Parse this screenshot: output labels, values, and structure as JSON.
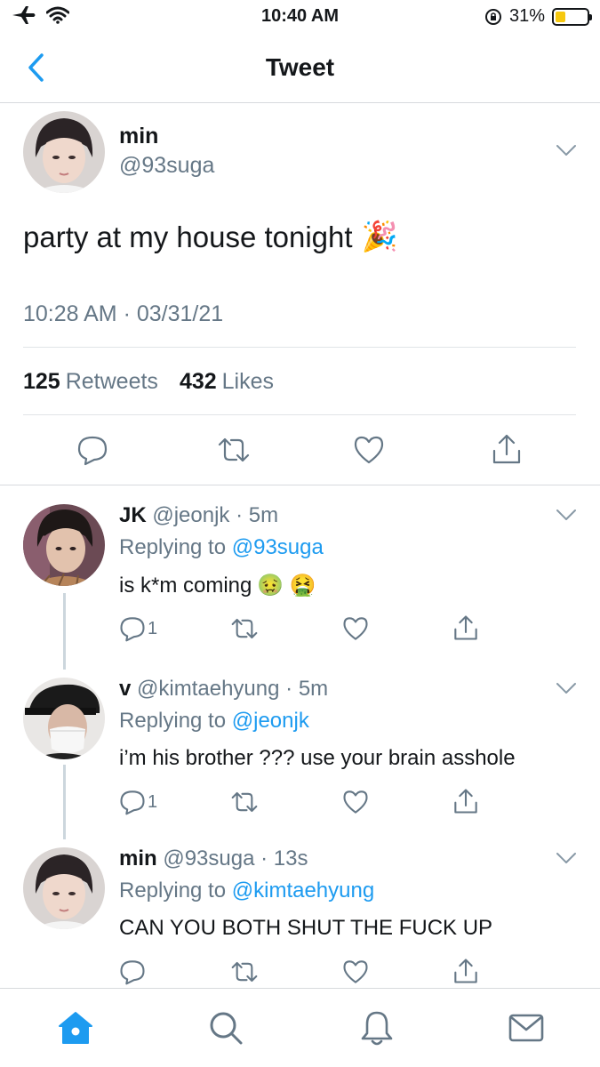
{
  "status_bar": {
    "time": "10:40 AM",
    "battery": "31%",
    "battery_level": 0.31
  },
  "nav": {
    "title": "Tweet"
  },
  "main_tweet": {
    "name": "min",
    "handle": "@93suga",
    "text": "party at my house tonight",
    "emoji": "🎉",
    "timestamp": "10:28 AM · 03/31/21",
    "retweets": "125",
    "retweets_label": "Retweets",
    "likes": "432",
    "likes_label": "Likes"
  },
  "replies": [
    {
      "name": "JK",
      "handle": "@jeonjk",
      "age": "· 5m",
      "replying_label": "Replying to",
      "replying_to": "@93suga",
      "text": "is k*m coming",
      "emoji": "🤢 🤮",
      "reply_count": "1"
    },
    {
      "name": "v",
      "handle": "@kimtaehyung",
      "age": "· 5m",
      "replying_label": "Replying to",
      "replying_to": "@jeonjk",
      "text": "i’m his brother ??? use your brain asshole",
      "reply_count": "1"
    },
    {
      "name": "min",
      "handle": "@93suga",
      "age": "· 13s",
      "replying_label": "Replying to",
      "replying_to": "@kimtaehyung",
      "text": "CAN YOU BOTH SHUT THE FUCK UP",
      "reply_count": ""
    }
  ],
  "colors": {
    "accent": "#1d9bf0",
    "secondary_text": "#657786",
    "divider": "#e1e4e7",
    "battery": "#f6c80f"
  },
  "tab_bar": {
    "items": [
      "home-icon",
      "search-icon",
      "bell-icon",
      "mail-icon"
    ],
    "active": "home-icon"
  }
}
